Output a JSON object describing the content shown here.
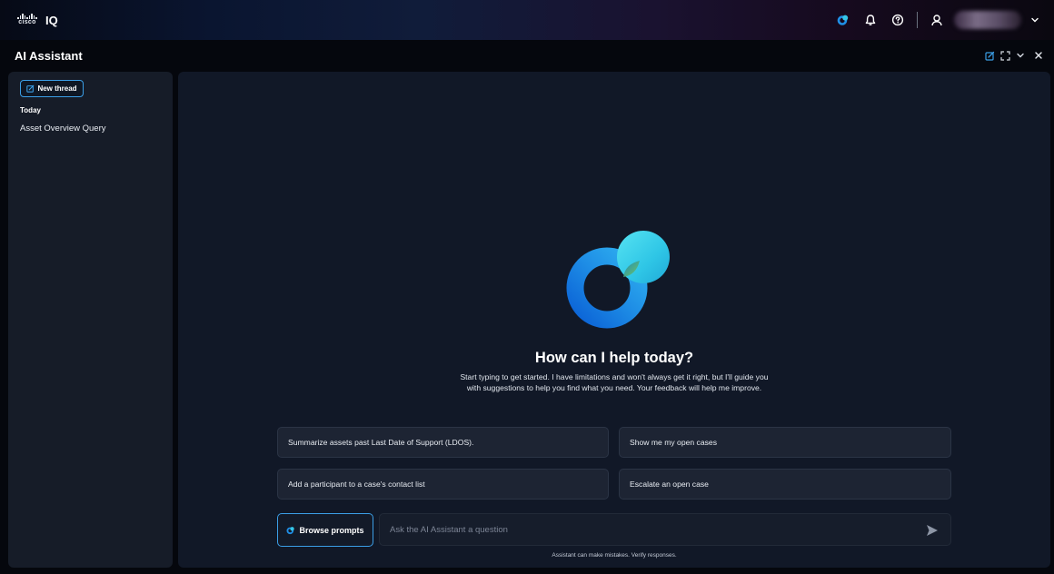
{
  "header": {
    "brand": "cisco",
    "app_name": "IQ",
    "icons": [
      "ai-assistant-icon",
      "bell-icon",
      "help-icon",
      "user-icon",
      "chevron-down-icon"
    ],
    "accent_color": "#1f8fe6"
  },
  "panel": {
    "title": "AI Assistant",
    "actions": [
      "new-thread-icon",
      "expand-icon",
      "chevron-down-icon",
      "close-icon"
    ]
  },
  "sidebar": {
    "new_thread_label": "New thread",
    "sections": [
      {
        "label": "Today",
        "items": [
          "Asset Overview Query"
        ]
      }
    ]
  },
  "main": {
    "heading": "How can I help today?",
    "subtext": "Start typing to get started. I have limitations and won't always get it right, but I'll guide you with suggestions to help you find what you need. Your feedback will help me improve.",
    "suggestions": [
      "Summarize assets past Last Date of Support (LDOS).",
      "Show me my open cases",
      "Add a participant to a case's contact list",
      "Escalate an open case"
    ],
    "browse_prompts_label": "Browse prompts",
    "input_placeholder": "Ask the AI Assistant a question",
    "disclaimer": "Assistant can make mistakes. Verify responses."
  }
}
